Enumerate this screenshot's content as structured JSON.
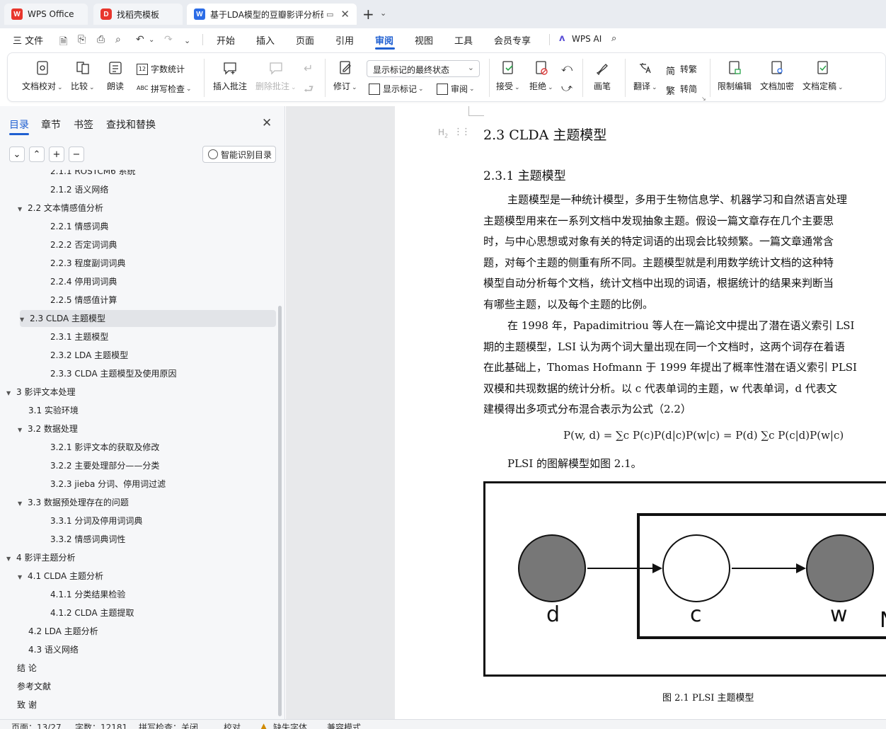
{
  "tabs": [
    {
      "label": "WPS Office",
      "icon": "wps-logo-icon"
    },
    {
      "label": "找稻壳模板",
      "icon": "docer-icon"
    },
    {
      "label": "基于LDA模型的豆瓣影评分析研究",
      "icon": "word-doc-icon"
    }
  ],
  "menubar": {
    "file": "三 文件",
    "items": [
      "开始",
      "插入",
      "页面",
      "引用",
      "审阅",
      "视图",
      "工具",
      "会员专享"
    ],
    "active": "审阅",
    "wps_ai": "WPS AI"
  },
  "ribbon": {
    "doc_proofread": "文档校对",
    "compare": "比较",
    "read_aloud": "朗读",
    "word_count": "字数统计",
    "spell_check": "拼写检查",
    "insert_comment": "插入批注",
    "delete_comment": "删除批注",
    "track_changes": "修订",
    "markup_state": "显示标记的最终状态",
    "show_markup": "显示标记",
    "review_pane": "审阅",
    "accept": "接受",
    "reject": "拒绝",
    "pen": "画笔",
    "translate": "翻译",
    "to_traditional": "转繁",
    "to_simplified": "转简",
    "restrict_edit": "限制编辑",
    "encrypt": "文档加密",
    "finalize": "文档定稿"
  },
  "nav": {
    "tabs": [
      "目录",
      "章节",
      "书签",
      "查找和替换"
    ],
    "active_tab": "目录",
    "smart_button": "智能识别目录",
    "toc": [
      {
        "label": "2.1.1 ROSTCM6 系统",
        "level": 3
      },
      {
        "label": "2.1.2  语义网络",
        "level": 3
      },
      {
        "label": "2.2  文本情感值分析",
        "level": 2,
        "expanded": true
      },
      {
        "label": "2.2.1  情感词典",
        "level": 3
      },
      {
        "label": "2.2.2  否定词词典",
        "level": 3
      },
      {
        "label": "2.2.3  程度副词词典",
        "level": 3
      },
      {
        "label": "2.2.4  停用词词典",
        "level": 3
      },
      {
        "label": "2.2.5  情感值计算",
        "level": 3
      },
      {
        "label": "2.3 CLDA 主题模型",
        "level": 2,
        "expanded": true,
        "selected": true
      },
      {
        "label": "2.3.1  主题模型",
        "level": 3
      },
      {
        "label": "2.3.2 LDA 主题模型",
        "level": 3
      },
      {
        "label": "2.3.3 CLDA 主题模型及使用原因",
        "level": 3
      },
      {
        "label": "3  影评文本处理",
        "level": 1,
        "expanded": true
      },
      {
        "label": "3.1  实验环境",
        "level": 2
      },
      {
        "label": "3.2  数据处理",
        "level": 2,
        "expanded": true
      },
      {
        "label": "3.2.1  影评文本的获取及修改",
        "level": 3
      },
      {
        "label": "3.2.2  主要处理部分——分类",
        "level": 3
      },
      {
        "label": "3.2.3 jieba 分词、停用词过滤",
        "level": 3
      },
      {
        "label": "3.3  数据预处理存在的问题",
        "level": 2,
        "expanded": true
      },
      {
        "label": "3.3.1  分词及停用词词典",
        "level": 3
      },
      {
        "label": "3.3.2  情感词典词性",
        "level": 3
      },
      {
        "label": "4  影评主题分析",
        "level": 1,
        "expanded": true
      },
      {
        "label": "4.1 CLDA 主题分析",
        "level": 2,
        "expanded": true
      },
      {
        "label": "4.1.1  分类结果检验",
        "level": 3
      },
      {
        "label": "4.1.2 CLDA 主题提取",
        "level": 3
      },
      {
        "label": "4.2 LDA 主题分析",
        "level": 2
      },
      {
        "label": "4.3  语义网络",
        "level": 2
      },
      {
        "label": "结  论",
        "level": 1
      },
      {
        "label": "参考文献",
        "level": 1
      },
      {
        "label": "致  谢",
        "level": 1
      }
    ]
  },
  "doc": {
    "heading2": "2.3 CLDA 主题模型",
    "heading3": "2.3.1  主题模型",
    "para1": [
      "主题模型是一种统计模型，多用于生物信息学、机器学习和自然语言处理",
      "主题模型用来在一系列文档中发现抽象主题。假设一篇文章存在几个主要思",
      "时，与中心思想或对象有关的特定词语的出现会比较频繁。一篇文章通常含",
      "题，对每个主题的侧重有所不同。主题模型就是利用数学统计文档的这种特",
      "模型自动分析每个文档，统计文档中出现的词语，根据统计的结果来判断当",
      "有哪些主题，以及每个主题的比例。"
    ],
    "para2": [
      "在 1998 年，Papadimitriou 等人在一篇论文中提出了潜在语义索引 LSI",
      "期的主题模型，LSI 认为两个词大量出现在同一个文档时，这两个词存在着语",
      "在此基础上，Thomas Hofmann 于 1999 年提出了概率性潜在语义索引 PLSI",
      "双模和共现数据的统计分析。以 c 代表单词的主题，w 代表单词，d 代表文",
      "建模得出多项式分布混合表示为公式（2.2）"
    ],
    "formula": "P(w, d) = ∑c P(c)P(d|c)P(w|c) = P(d) ∑c P(c|d)P(w|c)",
    "para3": "PLSI 的图解模型如图 2.1。",
    "figure_nodes": [
      "d",
      "c",
      "w",
      "N"
    ],
    "figure_caption": "图 2.1 PLSI 主题模型"
  },
  "status": {
    "page": "页面：13/27",
    "words": "字数：12181",
    "spell": "拼写检查：关闭",
    "proof": "校对",
    "missing_font": "缺失字体",
    "compat": "兼容模式"
  }
}
